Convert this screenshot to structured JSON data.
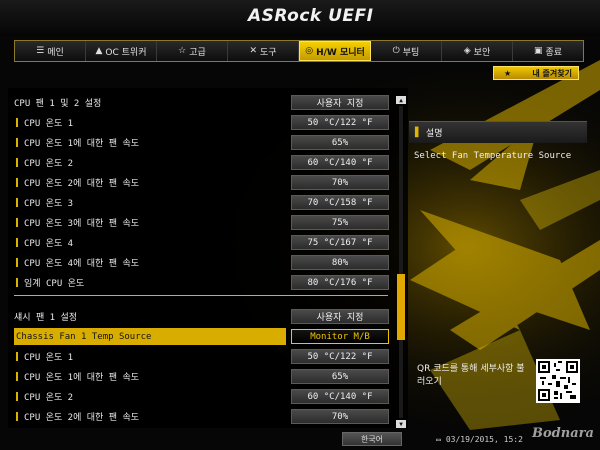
{
  "brand": "ASRock UEFI",
  "tabs": [
    {
      "label": "메인",
      "icon": "list-icon"
    },
    {
      "label": "OC 트위커",
      "icon": "rocket-icon"
    },
    {
      "label": "고급",
      "icon": "star-icon"
    },
    {
      "label": "도구",
      "icon": "tools-icon"
    },
    {
      "label": "H/W 모니터",
      "icon": "monitor-icon",
      "active": true
    },
    {
      "label": "부팅",
      "icon": "power-icon"
    },
    {
      "label": "보안",
      "icon": "shield-icon"
    },
    {
      "label": "종료",
      "icon": "exit-icon"
    }
  ],
  "favorites_label": "내 즐겨찾기",
  "settings": [
    {
      "label": "CPU 팬 1 및 2 설정",
      "value": "사용자 지정",
      "sub": false
    },
    {
      "label": "CPU 온도 1",
      "value": "50 °C/122 °F",
      "sub": true
    },
    {
      "label": "CPU 온도 1에 대한 팬 속도",
      "value": "65%",
      "sub": true
    },
    {
      "label": "CPU 온도 2",
      "value": "60 °C/140 °F",
      "sub": true
    },
    {
      "label": "CPU 온도 2에 대한 팬 속도",
      "value": "70%",
      "sub": true
    },
    {
      "label": "CPU 온도 3",
      "value": "70 °C/158 °F",
      "sub": true
    },
    {
      "label": "CPU 온도 3에 대한 팬 속도",
      "value": "75%",
      "sub": true
    },
    {
      "label": "CPU 온도 4",
      "value": "75 °C/167 °F",
      "sub": true
    },
    {
      "label": "CPU 온도 4에 대한 팬 속도",
      "value": "80%",
      "sub": true
    },
    {
      "label": "임계 CPU 온도",
      "value": "80 °C/176 °F",
      "sub": true
    },
    {
      "label": "섀시 팬 1 설정",
      "value": "사용자 지정",
      "sub": false
    },
    {
      "label": "Chassis Fan 1 Temp Source",
      "value": "Monitor M/B",
      "sub": false,
      "selected": true
    },
    {
      "label": "CPU 온도 1",
      "value": "50 °C/122 °F",
      "sub": true
    },
    {
      "label": "CPU 온도 1에 대한 팬 속도",
      "value": "65%",
      "sub": true
    },
    {
      "label": "CPU 온도 2",
      "value": "60 °C/140 °F",
      "sub": true
    },
    {
      "label": "CPU 온도 2에 대한 팬 속도",
      "value": "70%",
      "sub": true
    }
  ],
  "help": {
    "title": "설명",
    "text": "Select Fan Temperature Source",
    "qr_caption": "QR 코드를 통해 세부사항 불러오기"
  },
  "footer": {
    "language": "한국어",
    "datetime": "03/19/2015, 15:2"
  },
  "watermark": "Bodnara",
  "colors": {
    "accent": "#e0b400",
    "background": "#050505"
  }
}
